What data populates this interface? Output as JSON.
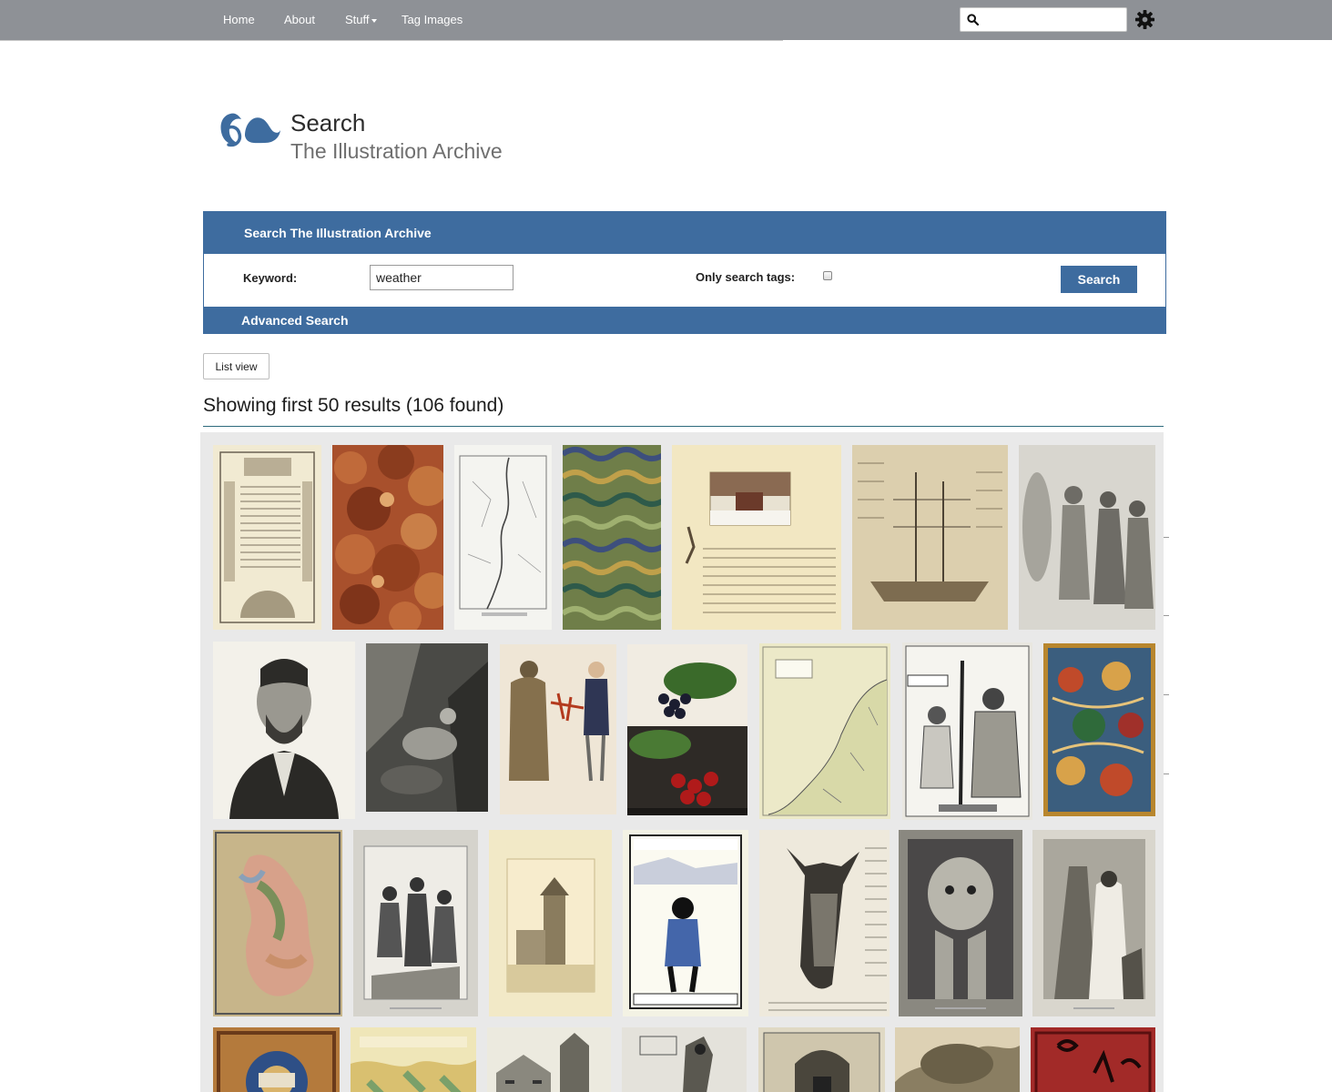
{
  "nav": {
    "items": [
      {
        "label": "Home"
      },
      {
        "label": "About"
      },
      {
        "label": "Stuff"
      },
      {
        "label": "Tag Images"
      }
    ],
    "search_value": "",
    "search_icon": "search-icon",
    "settings_icon": "gear-icon"
  },
  "header": {
    "title": "Search",
    "subtitle": "The Illustration Archive",
    "logo": "illustration-archive-logo"
  },
  "search_panel": {
    "title": "Search The Illustration Archive",
    "keyword_label": "Keyword:",
    "keyword_value": "weather",
    "tags_label": "Only search tags:",
    "tags_checked": false,
    "search_button": "Search",
    "advanced_label": "Advanced Search"
  },
  "results": {
    "list_view_button": "List view",
    "heading": "Showing first 50 results (106 found)"
  },
  "colors": {
    "nav_bg": "#8e9196",
    "accent": "#3e6c9f",
    "gallery_bg": "#e9e9e9"
  },
  "gallery": [
    {
      "subject": "engraved text page with architecture border",
      "tone": "#f1ead2"
    },
    {
      "subject": "red marbled paper",
      "tone": "#a8502c"
    },
    {
      "subject": "river map",
      "tone": "#f4f4f0"
    },
    {
      "subject": "green marbled paper",
      "tone": "#6f7e49"
    },
    {
      "subject": "winter cottage scene with text",
      "tone": "#f2e7c2"
    },
    {
      "subject": "sailing ship diagram",
      "tone": "#dccfae"
    },
    {
      "subject": "crowd engraving",
      "tone": "#d8d6cf"
    },
    {
      "subject": "portrait of bearded man",
      "tone": "#f3f1ea"
    },
    {
      "subject": "trench photograph",
      "tone": "#4a4a46"
    },
    {
      "subject": "two figures with lobster",
      "tone": "#efe6d6"
    },
    {
      "subject": "black and red cherries",
      "tone": "#2e2a26"
    },
    {
      "subject": "coastal map",
      "tone": "#ece9c8"
    },
    {
      "subject": "satirical cartoon",
      "tone": "#e9e7e0"
    },
    {
      "subject": "illuminated manuscript page",
      "tone": "#3b5e7e"
    },
    {
      "subject": "coloured geological map",
      "tone": "#c7b58a"
    },
    {
      "subject": "battle engraving",
      "tone": "#d5d3cc"
    },
    {
      "subject": "castle tower print",
      "tone": "#f2e9c7"
    },
    {
      "subject": "child in snow poster",
      "tone": "#f3f2e4"
    },
    {
      "subject": "horse head with text",
      "tone": "#eee9dc"
    },
    {
      "subject": "lion statue engraving",
      "tone": "#8a8880"
    },
    {
      "subject": "robed figures engraving",
      "tone": "#d9d6cd"
    },
    {
      "subject": "decorated manuscript cover",
      "tone": "#b47a3c"
    },
    {
      "subject": "english channel map",
      "tone": "#efe6b8"
    },
    {
      "subject": "gothic building engraving",
      "tone": "#eceadf"
    },
    {
      "subject": "egyptian figure",
      "tone": "#e4e2db"
    },
    {
      "subject": "cathedral doorway engraving",
      "tone": "#e0d9c4"
    },
    {
      "subject": "landscape engraving",
      "tone": "#ddd1b4"
    },
    {
      "subject": "red book cover",
      "tone": "#a22a28"
    }
  ]
}
